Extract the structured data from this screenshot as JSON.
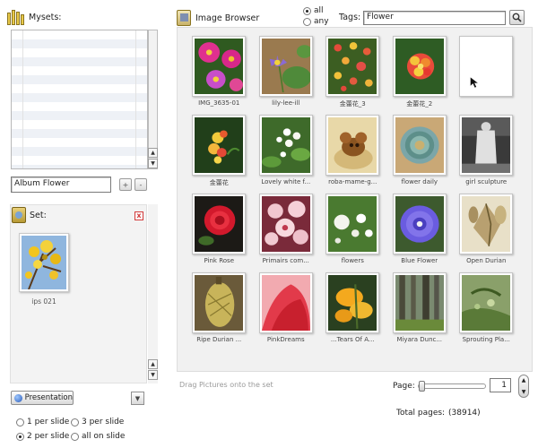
{
  "mysets": {
    "title": "Mysets:"
  },
  "album": {
    "value": "Album Flower",
    "add_label": "+",
    "remove_label": "-"
  },
  "set": {
    "title": "Set:",
    "close_label": "x",
    "items": [
      {
        "caption": "ips 021"
      }
    ]
  },
  "presentation": {
    "button_label": "Presentation",
    "options": [
      "1 per slide",
      "3 per slide",
      "2 per slide",
      "all on slide"
    ],
    "selected": "2 per slide"
  },
  "browser": {
    "title": "Image Browser",
    "scope": {
      "all_label": "all",
      "any_label": "any",
      "selected": "all"
    },
    "tags_label": "Tags:",
    "tags_value": "Flower"
  },
  "photos": [
    {
      "caption": "IMG_3635-01"
    },
    {
      "caption": "lily-lee-ill"
    },
    {
      "caption": "金蕾花_3"
    },
    {
      "caption": "金蕾花_2"
    },
    {
      "caption": ""
    },
    {
      "caption": "金蕾花"
    },
    {
      "caption": "Lovely white f..."
    },
    {
      "caption": "roba-mame-g..."
    },
    {
      "caption": "flower daily"
    },
    {
      "caption": "girl sculpture"
    },
    {
      "caption": "Pink Rose"
    },
    {
      "caption": "Primairs com..."
    },
    {
      "caption": "flowers"
    },
    {
      "caption": "Blue Flower"
    },
    {
      "caption": "Open Durian"
    },
    {
      "caption": "Ripe Durian ..."
    },
    {
      "caption": "PinkDreams"
    },
    {
      "caption": "...Tears Of A..."
    },
    {
      "caption": "Miyara Dunc..."
    },
    {
      "caption": "Sprouting Pla..."
    }
  ],
  "footer": {
    "drag_hint": "Drag Pictures onto the set",
    "page_label": "Page:",
    "page_value": "1",
    "total_label": "Total pages:",
    "total_value": "(38914)"
  }
}
